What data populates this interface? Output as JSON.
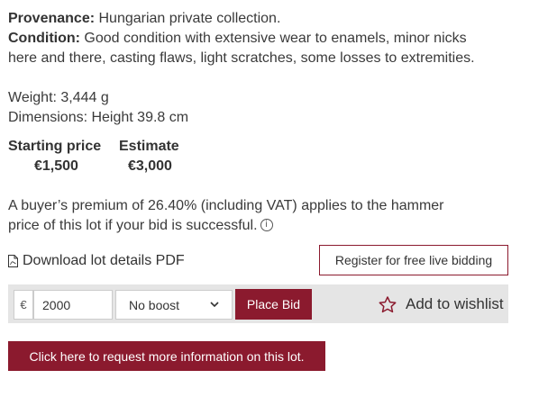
{
  "details": {
    "provenance_label": "Provenance:",
    "provenance_value": "Hungarian private collection.",
    "condition_label": "Condition:",
    "condition_line1": "Good condition with extensive wear to enamels, minor nicks",
    "condition_line2": "here and there, casting flaws, light scratches, some losses to extremities.",
    "weight": "Weight: 3,444 g",
    "dimensions": "Dimensions: Height 39.8 cm"
  },
  "pricing": {
    "starting_label": "Starting price",
    "starting_value": "€1,500",
    "estimate_label": "Estimate",
    "estimate_value": "€3,000"
  },
  "premium": {
    "line1": "A buyer’s premium of 26.40% (including VAT) applies to the hammer",
    "line2": "price of this lot if your bid is successful.",
    "info_icon": "i"
  },
  "actions": {
    "download_pdf": "Download lot details PDF",
    "register": "Register for free live bidding",
    "currency_symbol": "€",
    "bid_value": "2000",
    "boost_selected": "No boost",
    "place_bid": "Place Bid",
    "wishlist": "Add to wishlist",
    "request_info": "Click here to request more information on this lot."
  },
  "colors": {
    "accent": "#8b1a2e",
    "bid_bar_bg": "#e5e5e5"
  },
  "icons": {
    "pdf": "file-pdf-icon",
    "info": "info-circle-icon",
    "star": "star-outline-icon",
    "dropdown": "chevron-down-icon"
  }
}
